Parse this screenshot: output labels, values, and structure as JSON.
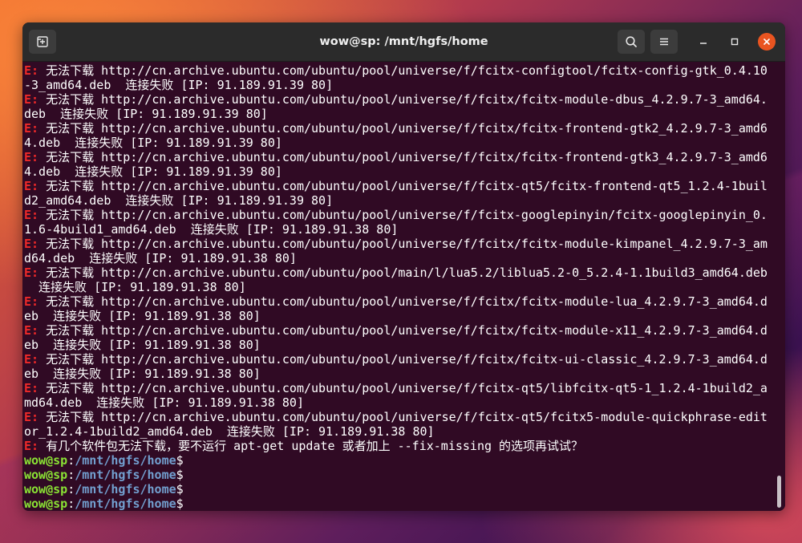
{
  "window": {
    "title": "wow@sp: /mnt/hgfs/home"
  },
  "icons": {
    "new_tab": "new-tab-icon",
    "search": "search-icon",
    "menu": "hamburger-menu-icon",
    "minimize": "minimize-icon",
    "maximize": "maximize-icon",
    "close": "close-icon"
  },
  "colors": {
    "terminal_bg": "#300a24",
    "error": "#ef2929",
    "prompt_user": "#8ae234",
    "prompt_path": "#729fcf",
    "close_button": "#e95420",
    "titlebar": "#2b2b2b"
  },
  "terminal": {
    "lines": [
      {
        "type": "err",
        "prefix": "E:",
        "text": " 无法下载 http://cn.archive.ubuntu.com/ubuntu/pool/universe/f/fcitx-configtool/fcitx-config-gtk_0.4.10"
      },
      {
        "type": "plain",
        "text": "-3_amd64.deb  连接失败 [IP: 91.189.91.39 80]"
      },
      {
        "type": "err",
        "prefix": "E:",
        "text": " 无法下载 http://cn.archive.ubuntu.com/ubuntu/pool/universe/f/fcitx/fcitx-module-dbus_4.2.9.7-3_amd64."
      },
      {
        "type": "plain",
        "text": "deb  连接失败 [IP: 91.189.91.39 80]"
      },
      {
        "type": "err",
        "prefix": "E:",
        "text": " 无法下载 http://cn.archive.ubuntu.com/ubuntu/pool/universe/f/fcitx/fcitx-frontend-gtk2_4.2.9.7-3_amd6"
      },
      {
        "type": "plain",
        "text": "4.deb  连接失败 [IP: 91.189.91.39 80]"
      },
      {
        "type": "err",
        "prefix": "E:",
        "text": " 无法下载 http://cn.archive.ubuntu.com/ubuntu/pool/universe/f/fcitx/fcitx-frontend-gtk3_4.2.9.7-3_amd6"
      },
      {
        "type": "plain",
        "text": "4.deb  连接失败 [IP: 91.189.91.39 80]"
      },
      {
        "type": "err",
        "prefix": "E:",
        "text": " 无法下载 http://cn.archive.ubuntu.com/ubuntu/pool/universe/f/fcitx-qt5/fcitx-frontend-qt5_1.2.4-1buil"
      },
      {
        "type": "plain",
        "text": "d2_amd64.deb  连接失败 [IP: 91.189.91.39 80]"
      },
      {
        "type": "err",
        "prefix": "E:",
        "text": " 无法下载 http://cn.archive.ubuntu.com/ubuntu/pool/universe/f/fcitx-googlepinyin/fcitx-googlepinyin_0."
      },
      {
        "type": "plain",
        "text": "1.6-4build1_amd64.deb  连接失败 [IP: 91.189.91.38 80]"
      },
      {
        "type": "err",
        "prefix": "E:",
        "text": " 无法下载 http://cn.archive.ubuntu.com/ubuntu/pool/universe/f/fcitx/fcitx-module-kimpanel_4.2.9.7-3_am"
      },
      {
        "type": "plain",
        "text": "d64.deb  连接失败 [IP: 91.189.91.38 80]"
      },
      {
        "type": "err",
        "prefix": "E:",
        "text": " 无法下载 http://cn.archive.ubuntu.com/ubuntu/pool/main/l/lua5.2/liblua5.2-0_5.2.4-1.1build3_amd64.deb"
      },
      {
        "type": "plain",
        "text": "  连接失败 [IP: 91.189.91.38 80]"
      },
      {
        "type": "err",
        "prefix": "E:",
        "text": " 无法下载 http://cn.archive.ubuntu.com/ubuntu/pool/universe/f/fcitx/fcitx-module-lua_4.2.9.7-3_amd64.d"
      },
      {
        "type": "plain",
        "text": "eb  连接失败 [IP: 91.189.91.38 80]"
      },
      {
        "type": "err",
        "prefix": "E:",
        "text": " 无法下载 http://cn.archive.ubuntu.com/ubuntu/pool/universe/f/fcitx/fcitx-module-x11_4.2.9.7-3_amd64.d"
      },
      {
        "type": "plain",
        "text": "eb  连接失败 [IP: 91.189.91.38 80]"
      },
      {
        "type": "err",
        "prefix": "E:",
        "text": " 无法下载 http://cn.archive.ubuntu.com/ubuntu/pool/universe/f/fcitx/fcitx-ui-classic_4.2.9.7-3_amd64.d"
      },
      {
        "type": "plain",
        "text": "eb  连接失败 [IP: 91.189.91.38 80]"
      },
      {
        "type": "err",
        "prefix": "E:",
        "text": " 无法下载 http://cn.archive.ubuntu.com/ubuntu/pool/universe/f/fcitx-qt5/libfcitx-qt5-1_1.2.4-1build2_a"
      },
      {
        "type": "plain",
        "text": "md64.deb  连接失败 [IP: 91.189.91.38 80]"
      },
      {
        "type": "err",
        "prefix": "E:",
        "text": " 无法下载 http://cn.archive.ubuntu.com/ubuntu/pool/universe/f/fcitx-qt5/fcitx5-module-quickphrase-edit"
      },
      {
        "type": "plain",
        "text": "or_1.2.4-1build2_amd64.deb  连接失败 [IP: 91.189.91.38 80]"
      },
      {
        "type": "err",
        "prefix": "E:",
        "text": " 有几个软件包无法下载，要不运行 apt-get update 或者加上 --fix-missing 的选项再试试？"
      },
      {
        "type": "prompt",
        "user": "wow@sp",
        "colon": ":",
        "path": "/mnt/hgfs/home",
        "dollar": "$"
      },
      {
        "type": "prompt",
        "user": "wow@sp",
        "colon": ":",
        "path": "/mnt/hgfs/home",
        "dollar": "$"
      },
      {
        "type": "prompt",
        "user": "wow@sp",
        "colon": ":",
        "path": "/mnt/hgfs/home",
        "dollar": "$"
      },
      {
        "type": "prompt",
        "user": "wow@sp",
        "colon": ":",
        "path": "/mnt/hgfs/home",
        "dollar": "$",
        "cursor": true
      }
    ]
  }
}
